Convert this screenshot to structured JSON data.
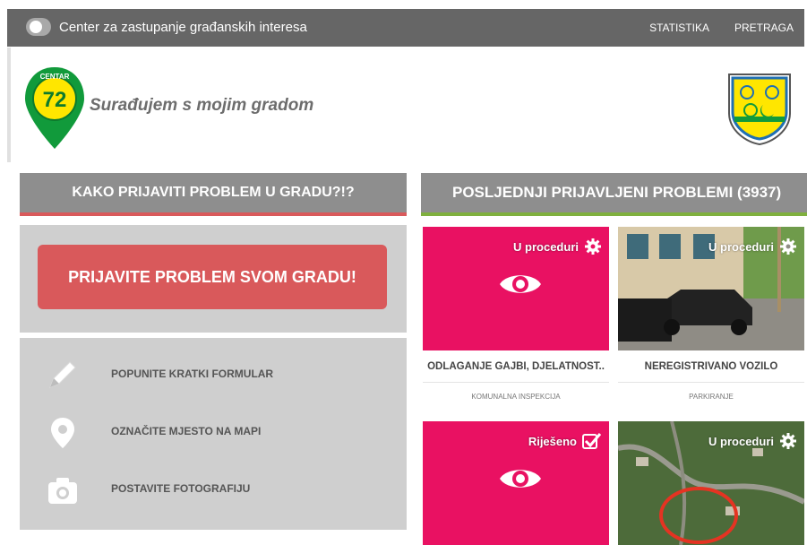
{
  "topbar": {
    "site_title": "Center za zastupanje građanskih interesa",
    "nav": [
      "STATISTIKA",
      "PRETRAGA"
    ]
  },
  "brand": {
    "logo_top": "CENTAR",
    "logo_number": "72",
    "tagline": "Surađujem s mojim gradom"
  },
  "left": {
    "header": "KAKO PRIJAVITI PROBLEM U GRADU?!?",
    "cta": "PRIJAVITE PROBLEM SVOM GRADU!",
    "steps": [
      {
        "label": "POPUNITE KRATKI FORMULAR",
        "icon": "pencil-icon"
      },
      {
        "label": "OZNAČITE MJESTO NA MAPI",
        "icon": "map-pin-icon"
      },
      {
        "label": "POSTAVITE FOTOGRAFIJU",
        "icon": "camera-icon"
      }
    ]
  },
  "right": {
    "header": "POSLJEDNJI PRIJAVLJENI PROBLEMI (3937)",
    "cards": [
      {
        "status": "U proceduri",
        "status_icon": "gear-icon",
        "title": "ODLAGANJE GAJBI, DJELATNOST..",
        "category": "KOMUNALNA INSPEKCIJA"
      },
      {
        "status": "U proceduri",
        "status_icon": "gear-icon",
        "title": "NEREGISTRIVANO VOZILO",
        "category": "PARKIRANJE"
      },
      {
        "status": "Riješeno",
        "status_icon": "checkbox-icon",
        "title": "",
        "category": ""
      },
      {
        "status": "U proceduri",
        "status_icon": "gear-icon",
        "title": "",
        "category": ""
      }
    ]
  },
  "colors": {
    "topbar": "#666666",
    "pink": "#e91162",
    "cta": "#d9595b",
    "green": "#7fb03e"
  }
}
